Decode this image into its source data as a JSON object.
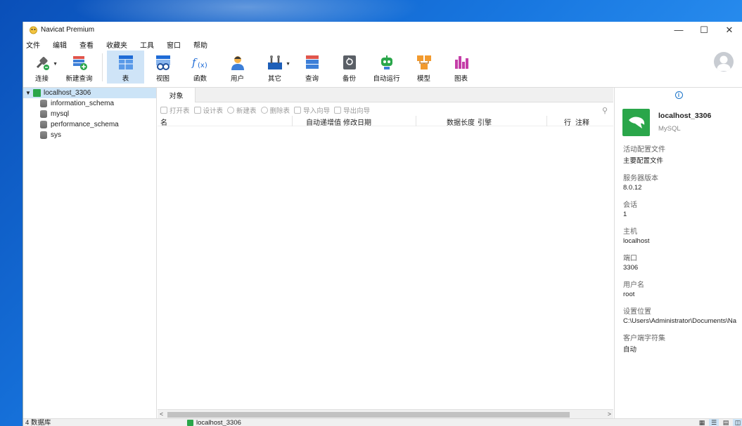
{
  "window": {
    "title": "Navicat Premium",
    "controls": {
      "minimize": "—",
      "maximize": "☐",
      "close": "✕"
    }
  },
  "menu": [
    "文件",
    "编辑",
    "查看",
    "收藏夹",
    "工具",
    "窗口",
    "帮助"
  ],
  "toolbar": {
    "items": [
      {
        "label": "连接",
        "icon": "connect-icon",
        "has_dropdown": true
      },
      {
        "label": "新建查询",
        "icon": "new-query-icon"
      },
      {
        "label": "表",
        "icon": "table-icon",
        "active": true
      },
      {
        "label": "视图",
        "icon": "view-icon"
      },
      {
        "label": "函数",
        "icon": "function-icon",
        "glyph": "f(x)"
      },
      {
        "label": "用户",
        "icon": "user-icon"
      },
      {
        "label": "其它",
        "icon": "other-icon",
        "has_dropdown": true
      },
      {
        "label": "查询",
        "icon": "query-icon"
      },
      {
        "label": "备份",
        "icon": "backup-icon"
      },
      {
        "label": "自动运行",
        "icon": "automation-icon"
      },
      {
        "label": "模型",
        "icon": "model-icon"
      },
      {
        "label": "图表",
        "icon": "chart-icon"
      }
    ]
  },
  "navigator": {
    "connection": "localhost_3306",
    "databases": [
      "information_schema",
      "mysql",
      "performance_schema",
      "sys"
    ]
  },
  "objects": {
    "tab": "对象",
    "actions": [
      "打开表",
      "设计表",
      "新建表",
      "删除表",
      "导入向导",
      "导出向导"
    ],
    "columns": [
      "名",
      "自动递增值",
      "修改日期",
      "数据长度",
      "引擎",
      "行",
      "注释"
    ]
  },
  "info": {
    "name": "localhost_3306",
    "type": "MySQL",
    "properties": [
      {
        "key": "活动配置文件",
        "value": "主要配置文件"
      },
      {
        "key": "服务器版本",
        "value": "8.0.12"
      },
      {
        "key": "会话",
        "value": "1"
      },
      {
        "key": "主机",
        "value": "localhost"
      },
      {
        "key": "端口",
        "value": "3306"
      },
      {
        "key": "用户名",
        "value": "root"
      },
      {
        "key": "设置位置",
        "value": "C:\\Users\\Administrator\\Documents\\Na"
      },
      {
        "key": "客户端字符集",
        "value": "自动"
      }
    ]
  },
  "status": {
    "count": "4 数据库",
    "connection": "localhost_3306"
  },
  "colors": {
    "accent": "#cfe4f7",
    "mysql_green": "#2aa64a"
  }
}
